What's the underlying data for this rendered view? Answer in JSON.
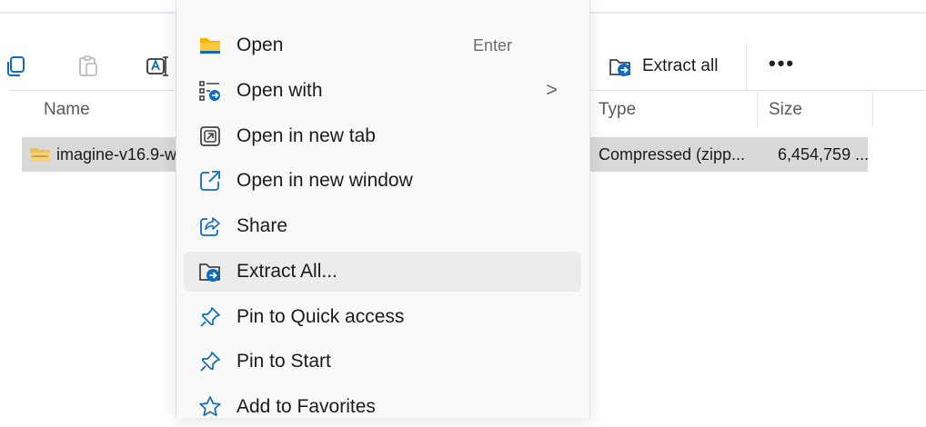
{
  "toolbar": {
    "extract_all_label": "Extract all",
    "more_label": "•••",
    "icons": [
      "copy-icon",
      "paste-icon",
      "rename-icon",
      "extract-icon"
    ]
  },
  "columns": {
    "name": "Name",
    "type": "Type",
    "size": "Size"
  },
  "file": {
    "name": "imagine-v16.9-w",
    "type": "Compressed (zipp...",
    "size": "6,454,759 ..."
  },
  "context_menu": {
    "items": [
      {
        "label": "Open",
        "shortcut": "Enter",
        "icon": "folder-icon"
      },
      {
        "label": "Open with",
        "chevron": ">",
        "icon": "open-with-icon"
      },
      {
        "label": "Open in new tab",
        "icon": "new-tab-icon"
      },
      {
        "label": "Open in new window",
        "icon": "new-window-icon"
      },
      {
        "label": "Share",
        "icon": "share-icon"
      },
      {
        "label": "Extract All...",
        "icon": "extract-icon"
      },
      {
        "label": "Pin to Quick access",
        "icon": "pin-icon"
      },
      {
        "label": "Pin to Start",
        "icon": "pin-icon"
      },
      {
        "label": "Add to Favorites",
        "icon": "star-icon"
      }
    ]
  },
  "colors": {
    "accent": "#0f6cbd",
    "folder": "#f4b400",
    "selection": "#d9d9d9",
    "menu_hover": "#ececec"
  }
}
